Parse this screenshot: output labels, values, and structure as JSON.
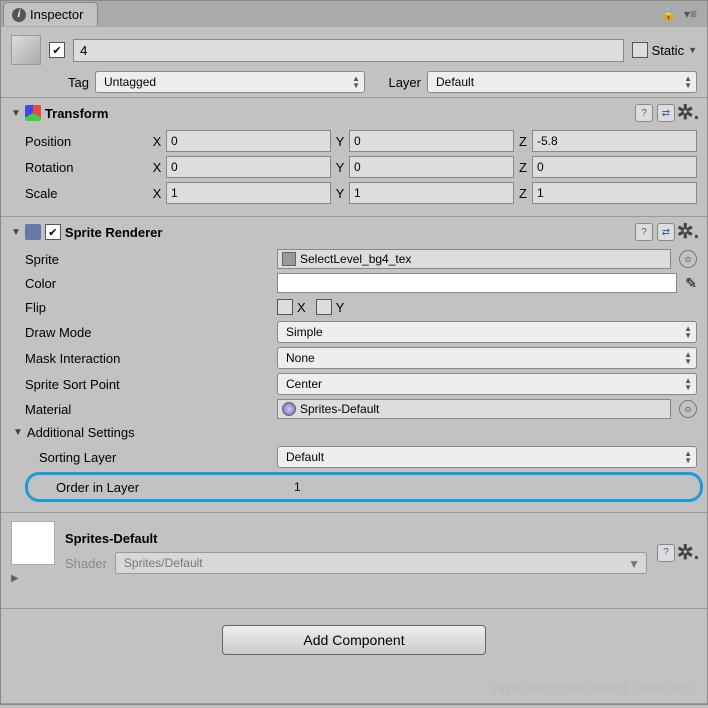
{
  "tab": {
    "title": "Inspector"
  },
  "gameObject": {
    "name": "4",
    "staticLabel": "Static",
    "tagLabel": "Tag",
    "tagValue": "Untagged",
    "layerLabel": "Layer",
    "layerValue": "Default"
  },
  "transform": {
    "title": "Transform",
    "position": {
      "label": "Position",
      "x": "0",
      "y": "0",
      "z": "-5.8"
    },
    "rotation": {
      "label": "Rotation",
      "x": "0",
      "y": "0",
      "z": "0"
    },
    "scale": {
      "label": "Scale",
      "x": "1",
      "y": "1",
      "z": "1"
    }
  },
  "spriteRenderer": {
    "title": "Sprite Renderer",
    "sprite": {
      "label": "Sprite",
      "value": "SelectLevel_bg4_tex"
    },
    "color": {
      "label": "Color"
    },
    "flip": {
      "label": "Flip",
      "x": "X",
      "y": "Y"
    },
    "drawMode": {
      "label": "Draw Mode",
      "value": "Simple"
    },
    "maskInteraction": {
      "label": "Mask Interaction",
      "value": "None"
    },
    "spriteSortPoint": {
      "label": "Sprite Sort Point",
      "value": "Center"
    },
    "material": {
      "label": "Material",
      "value": "Sprites-Default"
    },
    "additionalSettings": "Additional Settings",
    "sortingLayer": {
      "label": "Sorting Layer",
      "value": "Default"
    },
    "orderInLayer": {
      "label": "Order in Layer",
      "value": "1"
    }
  },
  "materialSection": {
    "name": "Sprites-Default",
    "shaderLabel": "Shader",
    "shaderValue": "Sprites/Default"
  },
  "addComponent": "Add Component",
  "watermark": "https://blog.csdn.net/qq_29847807"
}
